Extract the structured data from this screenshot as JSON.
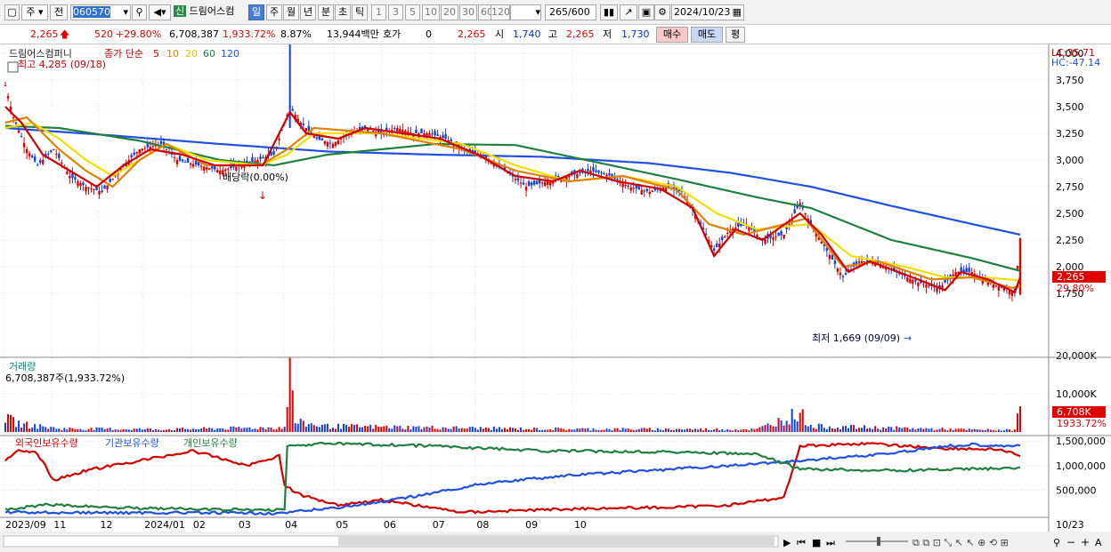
{
  "toolbar": {
    "code": "060570",
    "name_badge": "신",
    "name": "드림어스컴",
    "day_tab": "일",
    "period_tabs": [
      "주",
      "월",
      "년",
      "분",
      "초",
      "틱"
    ],
    "interval_buttons": [
      "1",
      "3",
      "5",
      "10",
      "20",
      "30",
      "60",
      "120"
    ],
    "count": "265",
    "count_total": "/600",
    "date": "2024/10/23",
    "market_btn": "주",
    "prev_btn": "전"
  },
  "quote": {
    "price": "2,265",
    "change": "520",
    "change_pct": "+29.80%",
    "volume": "6,708,387",
    "volume_pct": "1,933.72%",
    "turnover": "8.87%",
    "amount": "13,944백만",
    "bid_label": "호가",
    "bid": "0",
    "bid_price": "2,265",
    "open_label": "시",
    "open": "1,740",
    "high_label": "고",
    "high": "2,265",
    "low_label": "저",
    "low": "1,730",
    "buy": "매수",
    "sell": "매도",
    "avg": "평"
  },
  "chart": {
    "title": "드림어스컴퍼니",
    "legend_head": "종가 단순",
    "ma": [
      {
        "label": "5",
        "color": "#d00000"
      },
      {
        "label": "10",
        "color": "#e08000"
      },
      {
        "label": "20",
        "color": "#f0e000"
      },
      {
        "label": "60",
        "color": "#208040"
      },
      {
        "label": "120",
        "color": "#2050e0"
      }
    ],
    "high_note": "최고 4,285 (09/18)",
    "low_note": "최저 1,669 (09/09)",
    "dividend_note": "배당락(0.00%)",
    "lc": "LC:35.71",
    "hc": "HC:-47.14",
    "price_tag": "2,265",
    "pct_tag": "29.80%",
    "vol_title": "거래량",
    "vol_note": "6,708,387주(1,933.72%)",
    "vol_tag": "6,708K",
    "vol_pct_tag": "1933.72%",
    "holders": [
      {
        "label": "외국인보유수량",
        "color": "#d00000"
      },
      {
        "label": "기관보유수량",
        "color": "#2050e0"
      },
      {
        "label": "개인보유수량",
        "color": "#208040"
      }
    ]
  },
  "chart_data": {
    "type": "candlestick",
    "ticks": [
      "4,000",
      "3,750",
      "3,500",
      "3,250",
      "3,000",
      "2,750",
      "2,500",
      "2,250",
      "2,000",
      "1,750"
    ],
    "tick_values": [
      4000,
      3750,
      3500,
      3250,
      3000,
      2750,
      2500,
      2250,
      2000,
      1750
    ],
    "vol_ticks": [
      "20,000K",
      "10,000K"
    ],
    "vol_tick_values": [
      20000,
      10000
    ],
    "holder_ticks": [
      "1,500,000",
      "1,000,000",
      "500,000"
    ],
    "holder_tick_values": [
      1500000,
      1000000,
      500000
    ],
    "x_labels": [
      "2023/09",
      "11",
      "12",
      "2024/01",
      "02",
      "03",
      "04",
      "05",
      "06",
      "07",
      "08",
      "09",
      "10",
      "10/23"
    ],
    "close_keypoints": [
      [
        0,
        3700
      ],
      [
        3,
        3400
      ],
      [
        8,
        3100
      ],
      [
        12,
        2950
      ],
      [
        18,
        3100
      ],
      [
        24,
        2850
      ],
      [
        30,
        2750
      ],
      [
        36,
        2700
      ],
      [
        44,
        2950
      ],
      [
        50,
        3100
      ],
      [
        58,
        3150
      ],
      [
        64,
        3000
      ],
      [
        72,
        2950
      ],
      [
        80,
        2900
      ],
      [
        88,
        2950
      ],
      [
        94,
        3000
      ],
      [
        100,
        3050
      ],
      [
        106,
        3500
      ],
      [
        110,
        3350
      ],
      [
        116,
        3200
      ],
      [
        122,
        3150
      ],
      [
        128,
        3250
      ],
      [
        134,
        3300
      ],
      [
        140,
        3250
      ],
      [
        146,
        3300
      ],
      [
        152,
        3250
      ],
      [
        158,
        3250
      ],
      [
        164,
        3200
      ],
      [
        170,
        3100
      ],
      [
        178,
        3050
      ],
      [
        186,
        2900
      ],
      [
        194,
        2750
      ],
      [
        202,
        2800
      ],
      [
        210,
        2850
      ],
      [
        218,
        2900
      ],
      [
        226,
        2850
      ],
      [
        232,
        2750
      ],
      [
        240,
        2700
      ],
      [
        246,
        2750
      ],
      [
        252,
        2700
      ],
      [
        258,
        2450
      ],
      [
        264,
        2150
      ],
      [
        270,
        2350
      ],
      [
        276,
        2400
      ],
      [
        282,
        2250
      ],
      [
        290,
        2300
      ],
      [
        296,
        2600
      ],
      [
        300,
        2400
      ],
      [
        306,
        2150
      ],
      [
        312,
        1900
      ],
      [
        318,
        2050
      ],
      [
        324,
        2050
      ],
      [
        332,
        1950
      ],
      [
        340,
        1850
      ],
      [
        348,
        1800
      ],
      [
        354,
        1950
      ],
      [
        360,
        1950
      ],
      [
        366,
        1850
      ],
      [
        372,
        1800
      ],
      [
        376,
        1750
      ],
      [
        378,
        2265
      ]
    ],
    "ma_120_keypoints": [
      [
        0,
        3300
      ],
      [
        40,
        3230
      ],
      [
        80,
        3150
      ],
      [
        120,
        3080
      ],
      [
        160,
        3050
      ],
      [
        200,
        3030
      ],
      [
        240,
        2970
      ],
      [
        270,
        2880
      ],
      [
        300,
        2750
      ],
      [
        330,
        2570
      ],
      [
        360,
        2400
      ],
      [
        378,
        2300
      ]
    ],
    "ma_60_keypoints": [
      [
        0,
        3320
      ],
      [
        20,
        3300
      ],
      [
        50,
        3180
      ],
      [
        80,
        3000
      ],
      [
        100,
        2950
      ],
      [
        120,
        3050
      ],
      [
        160,
        3150
      ],
      [
        190,
        3140
      ],
      [
        220,
        2980
      ],
      [
        250,
        2820
      ],
      [
        280,
        2650
      ],
      [
        300,
        2550
      ],
      [
        330,
        2250
      ],
      [
        360,
        2080
      ],
      [
        378,
        1960
      ]
    ],
    "ma_20_keypoints": [
      [
        0,
        3300
      ],
      [
        10,
        3350
      ],
      [
        20,
        3200
      ],
      [
        30,
        3000
      ],
      [
        40,
        2850
      ],
      [
        50,
        3000
      ],
      [
        60,
        3150
      ],
      [
        75,
        3000
      ],
      [
        95,
        2950
      ],
      [
        105,
        3050
      ],
      [
        115,
        3250
      ],
      [
        140,
        3250
      ],
      [
        170,
        3150
      ],
      [
        190,
        2950
      ],
      [
        210,
        2800
      ],
      [
        230,
        2850
      ],
      [
        250,
        2750
      ],
      [
        265,
        2500
      ],
      [
        280,
        2350
      ],
      [
        300,
        2400
      ],
      [
        315,
        2100
      ],
      [
        335,
        2000
      ],
      [
        350,
        1900
      ],
      [
        365,
        1900
      ],
      [
        378,
        1870
      ]
    ],
    "ma_10_keypoints": [
      [
        0,
        3350
      ],
      [
        8,
        3400
      ],
      [
        20,
        3100
      ],
      [
        30,
        2900
      ],
      [
        40,
        2750
      ],
      [
        50,
        3000
      ],
      [
        60,
        3150
      ],
      [
        75,
        2950
      ],
      [
        95,
        2950
      ],
      [
        105,
        3100
      ],
      [
        115,
        3300
      ],
      [
        140,
        3250
      ],
      [
        170,
        3100
      ],
      [
        190,
        2900
      ],
      [
        210,
        2800
      ],
      [
        230,
        2850
      ],
      [
        250,
        2720
      ],
      [
        262,
        2400
      ],
      [
        275,
        2300
      ],
      [
        298,
        2450
      ],
      [
        312,
        2000
      ],
      [
        325,
        2050
      ],
      [
        345,
        1880
      ],
      [
        360,
        1900
      ],
      [
        375,
        1800
      ],
      [
        378,
        1820
      ]
    ],
    "ma_5_keypoints": [
      [
        0,
        3500
      ],
      [
        6,
        3350
      ],
      [
        14,
        3050
      ],
      [
        24,
        2900
      ],
      [
        34,
        2750
      ],
      [
        44,
        2950
      ],
      [
        54,
        3100
      ],
      [
        66,
        3050
      ],
      [
        78,
        2950
      ],
      [
        96,
        2950
      ],
      [
        106,
        3450
      ],
      [
        112,
        3250
      ],
      [
        124,
        3200
      ],
      [
        134,
        3300
      ],
      [
        148,
        3250
      ],
      [
        162,
        3200
      ],
      [
        176,
        3050
      ],
      [
        190,
        2850
      ],
      [
        204,
        2800
      ],
      [
        214,
        2900
      ],
      [
        228,
        2800
      ],
      [
        244,
        2730
      ],
      [
        256,
        2550
      ],
      [
        264,
        2100
      ],
      [
        272,
        2350
      ],
      [
        282,
        2250
      ],
      [
        296,
        2500
      ],
      [
        304,
        2300
      ],
      [
        314,
        1950
      ],
      [
        322,
        2050
      ],
      [
        340,
        1880
      ],
      [
        350,
        1780
      ],
      [
        356,
        1950
      ],
      [
        366,
        1880
      ],
      [
        376,
        1760
      ],
      [
        378,
        1900
      ]
    ],
    "volume_keypoints": [
      [
        0,
        3500
      ],
      [
        6,
        2000
      ],
      [
        20,
        900
      ],
      [
        60,
        700
      ],
      [
        104,
        1200
      ],
      [
        106,
        19500
      ],
      [
        108,
        2500
      ],
      [
        120,
        1500
      ],
      [
        200,
        800
      ],
      [
        280,
        700
      ],
      [
        296,
        5000
      ],
      [
        300,
        1500
      ],
      [
        360,
        600
      ],
      [
        376,
        500
      ],
      [
        378,
        6708
      ]
    ],
    "foreign_keypoints": [
      [
        0,
        1100000
      ],
      [
        5,
        1300000
      ],
      [
        12,
        1250000
      ],
      [
        18,
        700000
      ],
      [
        30,
        900000
      ],
      [
        50,
        1100000
      ],
      [
        70,
        1300000
      ],
      [
        90,
        1000000
      ],
      [
        102,
        1200000
      ],
      [
        104,
        600000
      ],
      [
        110,
        400000
      ],
      [
        124,
        200000
      ],
      [
        140,
        300000
      ],
      [
        170,
        50000
      ],
      [
        200,
        100000
      ],
      [
        220,
        130000
      ],
      [
        250,
        150000
      ],
      [
        270,
        200000
      ],
      [
        290,
        350000
      ],
      [
        296,
        1400000
      ],
      [
        320,
        1450000
      ],
      [
        350,
        1350000
      ],
      [
        370,
        1330000
      ],
      [
        378,
        1200000
      ]
    ],
    "institution_keypoints": [
      [
        0,
        50000
      ],
      [
        30,
        40000
      ],
      [
        60,
        40000
      ],
      [
        104,
        30000
      ],
      [
        110,
        70000
      ],
      [
        124,
        150000
      ],
      [
        140,
        250000
      ],
      [
        160,
        450000
      ],
      [
        180,
        650000
      ],
      [
        210,
        800000
      ],
      [
        240,
        900000
      ],
      [
        270,
        1000000
      ],
      [
        296,
        1100000
      ],
      [
        330,
        1250000
      ],
      [
        350,
        1400000
      ],
      [
        360,
        1430000
      ],
      [
        378,
        1400000
      ]
    ],
    "individual_keypoints": [
      [
        0,
        100000
      ],
      [
        15,
        200000
      ],
      [
        40,
        150000
      ],
      [
        80,
        100000
      ],
      [
        104,
        100000
      ],
      [
        105,
        1400000
      ],
      [
        120,
        1450000
      ],
      [
        160,
        1400000
      ],
      [
        200,
        1300000
      ],
      [
        250,
        1280000
      ],
      [
        280,
        1230000
      ],
      [
        296,
        930000
      ],
      [
        330,
        900000
      ],
      [
        378,
        950000
      ]
    ]
  }
}
